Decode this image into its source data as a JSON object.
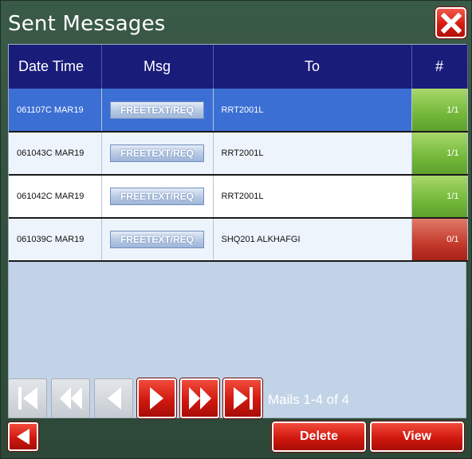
{
  "window": {
    "title": "Sent Messages"
  },
  "table": {
    "headers": {
      "datetime": "Date Time",
      "msg": "Msg",
      "to": "To",
      "count": "#"
    },
    "rows": [
      {
        "datetime": "061107C MAR19",
        "msg": "FREETEXT/REQ",
        "to": "RRT2001L",
        "count": "1/1",
        "status": "ok",
        "selected": true
      },
      {
        "datetime": "061043C MAR19",
        "msg": "FREETEXT/REQ",
        "to": "RRT2001L",
        "count": "1/1",
        "status": "ok",
        "selected": false
      },
      {
        "datetime": "061042C MAR19",
        "msg": "FREETEXT/REQ",
        "to": "RRT2001L",
        "count": "1/1",
        "status": "ok",
        "selected": false
      },
      {
        "datetime": "061039C MAR19",
        "msg": "FREETEXT/REQ",
        "to": "SHQ201 ALKHAFGI",
        "count": "0/1",
        "status": "fail",
        "selected": false
      }
    ]
  },
  "pager": {
    "summary": "Mails 1-4 of 4",
    "buttons": [
      {
        "name": "first-page-icon",
        "enabled": false
      },
      {
        "name": "rewind-icon",
        "enabled": false
      },
      {
        "name": "previous-icon",
        "enabled": false
      },
      {
        "name": "next-icon",
        "enabled": true
      },
      {
        "name": "fast-forward-icon",
        "enabled": true
      },
      {
        "name": "last-page-icon",
        "enabled": true
      }
    ]
  },
  "actions": {
    "delete_label": "Delete",
    "view_label": "View"
  },
  "colors": {
    "header_bg": "#1a1c7a",
    "selected_row": "#3b6fd4",
    "ok_status": "#74b83a",
    "fail_status": "#c43a2c",
    "button_red": "#d0180f",
    "panel_bg": "#c3d3e7"
  }
}
